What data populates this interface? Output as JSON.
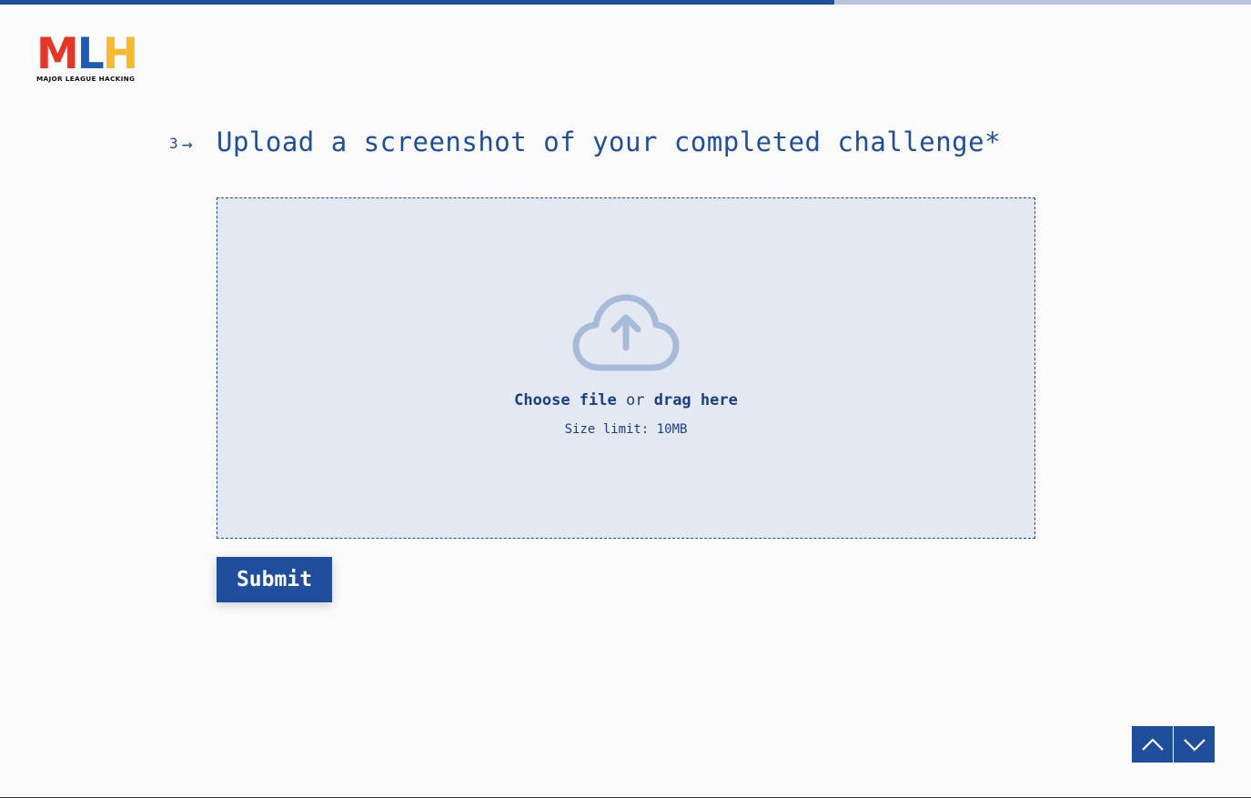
{
  "progress": {
    "fraction": 0.667
  },
  "logo": {
    "m": "M",
    "l": "L",
    "h": "H",
    "tagline": "MAJOR LEAGUE HACKING"
  },
  "question": {
    "number": "3",
    "arrow": "→",
    "title": "Upload a screenshot of your completed challenge*"
  },
  "upload": {
    "icon": "cloud-upload-icon",
    "choose": "Choose file",
    "or": "or",
    "drag": "drag here",
    "size_limit": "Size limit: 10MB"
  },
  "submit_label": "Submit",
  "nav": {
    "up_icon": "chevron-up-icon",
    "down_icon": "chevron-down-icon"
  },
  "colors": {
    "primary": "#1e4e9c",
    "dropzone_bg": "#e3e8f1",
    "progress_track": "#b6c5dd",
    "logo_red": "#e73427",
    "logo_blue": "#1d5bb8",
    "logo_yellow": "#f8b92a"
  }
}
